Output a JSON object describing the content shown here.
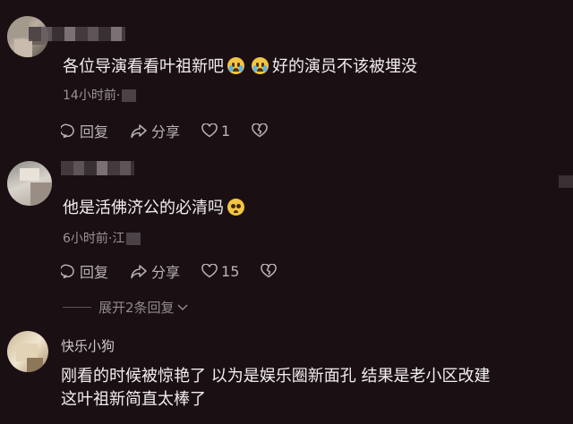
{
  "comments": [
    {
      "text_a": "各位导演看看叶祖新吧",
      "text_b": "好的演员不该被埋没",
      "time": "14小时前·",
      "actions": {
        "reply": "回复",
        "share": "分享",
        "like_count": "1"
      }
    },
    {
      "text": "他是活佛济公的必清吗",
      "time": "6小时前·江",
      "actions": {
        "reply": "回复",
        "share": "分享",
        "like_count": "15"
      }
    },
    {
      "username": "快乐小狗",
      "text_line1": "刚看的时候被惊艳了 以为是娱乐圈新面孔 结果是老小区改建",
      "text_line2": "这叶祖新简直太棒了"
    }
  ],
  "expand_label": "展开2条回复",
  "icons": [
    "reply-icon",
    "share-icon",
    "heart-icon",
    "broken-heart-icon",
    "crying-emoji-icon",
    "pleading-emoji-icon",
    "chevron-down-icon"
  ],
  "colors": {
    "background": "#1a1014",
    "text": "#f1eef0",
    "muted": "#9b9497"
  }
}
